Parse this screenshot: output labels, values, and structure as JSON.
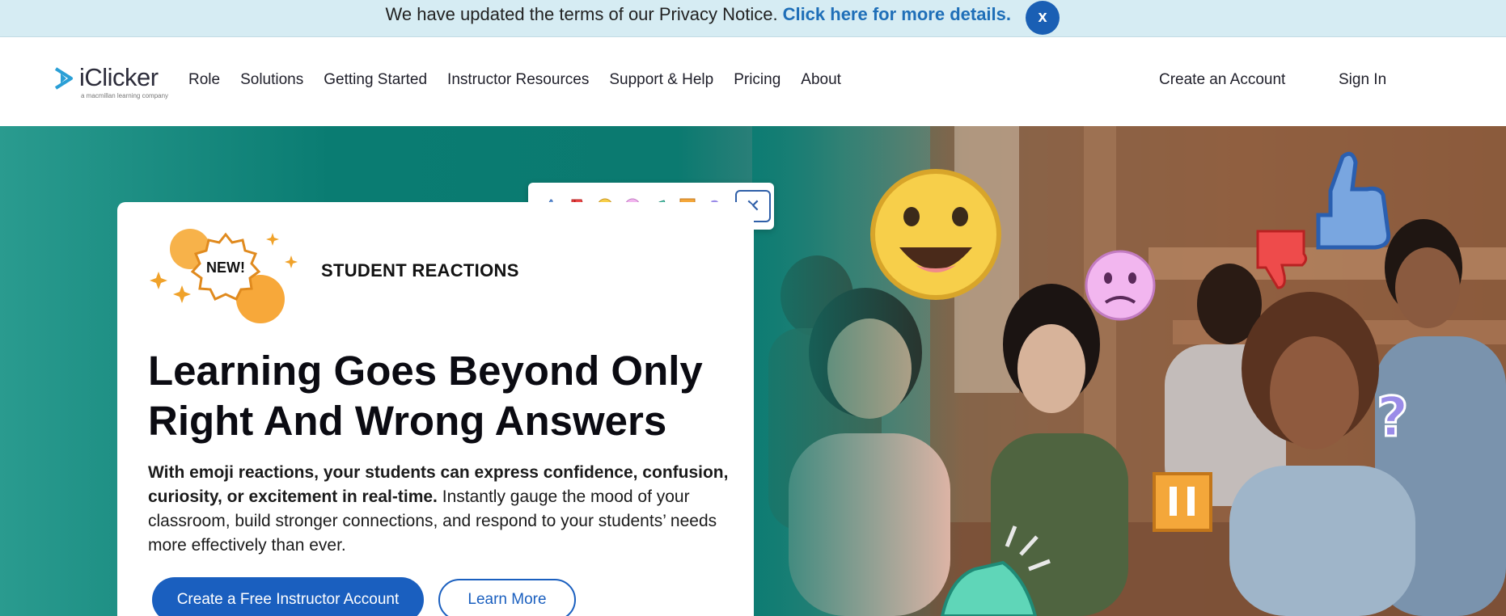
{
  "banner": {
    "text": "We have updated the terms of our Privacy Notice.",
    "link": "Click here for more details.",
    "close": "x"
  },
  "logo": {
    "name": "iClicker",
    "tagline": "a macmillan learning company"
  },
  "nav": {
    "items": [
      "Role",
      "Solutions",
      "Getting Started",
      "Instructor Resources",
      "Support & Help",
      "Pricing",
      "About"
    ],
    "create_account": "Create an Account",
    "sign_in": "Sign In"
  },
  "hero": {
    "badge": "NEW!",
    "eyebrow": "STUDENT REACTIONS",
    "title": "Learning Goes Beyond Only Right And Wrong Answers",
    "body_bold": "With emoji reactions, your students can express confidence, confusion, curiosity, or excitement in real-time.",
    "body_rest": " Instantly gauge the mood of your classroom, build stronger connections, and respond to your students’ needs more effectively than ever.",
    "primary_button": "Create a Free Instructor Account",
    "secondary_button": "Learn More"
  },
  "reactions": {
    "icons": [
      "thumbs-up-icon",
      "thumbs-down-icon",
      "smile-icon",
      "confused-icon",
      "clapping-hands-icon",
      "pause-icon",
      "question-icon"
    ],
    "close": "✕"
  },
  "colors": {
    "brand_blue": "#1a5fbf",
    "banner_bg": "#d6ecf3",
    "teal": "#0a7c72"
  }
}
